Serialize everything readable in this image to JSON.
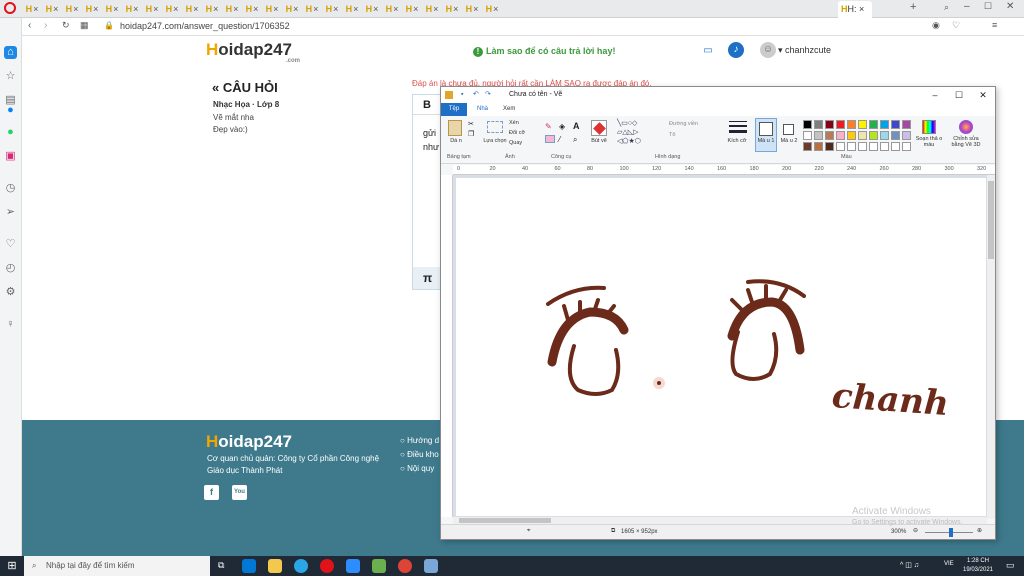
{
  "browser": {
    "tab_count": 24,
    "active_tab": "H:",
    "tab_logo_letter": "H",
    "tab_close": "×",
    "new_tab": "+",
    "url": "hoidap247.com/answer_question/1706352"
  },
  "site": {
    "logo_h": "H",
    "logo_rest": "oidap247",
    "logo_sub": ".com",
    "tip": "Làm sao để có câu trả lời hay!",
    "user": "chanhzcute"
  },
  "question": {
    "title": "CÂU HỎI",
    "subject": "Nhạc Họa · Lớp 8",
    "line1": "Vẽ mắt nha",
    "line2": "Đẹp vào:)",
    "hint": "Đáp án là chưa đủ, người hỏi rất cần LÀM SAO ra được đáp án đó.",
    "editor_bold": "B",
    "editor_text1": "gửi",
    "editor_text2": "như",
    "editor_pi": "π"
  },
  "paint": {
    "title": "Chưa có tên - Vẽ",
    "tabs": [
      "Tệp",
      "Nhà",
      "Xem"
    ],
    "groups": [
      "Bảng tạm",
      "Ảnh",
      "Công cụ",
      "Hình dạng",
      "Màu"
    ],
    "items": {
      "paste": "Dá n",
      "select": "Lựa chọn",
      "crop": "Xén",
      "resize": "Đổi cỡ",
      "rotate": "Quay",
      "brush": "Bút vẽ",
      "outline": "Đường viền",
      "fill": "Tô",
      "size": "Kích cỡ",
      "color1": "Mà u 1",
      "color2": "Mà u 2",
      "edit_colors": "Soạn thả o màu",
      "paint3d": "Chỉnh sửa bằng Vẽ 3D"
    },
    "ruler_ticks": [
      "0",
      "20",
      "40",
      "60",
      "80",
      "100",
      "120",
      "140",
      "160",
      "180",
      "200",
      "220",
      "240",
      "260",
      "280",
      "300",
      "320"
    ],
    "drawing_text": "chanh",
    "size_status": "1605 × 952px",
    "zoom": "300%"
  },
  "palette": [
    "#000000",
    "#7f7f7f",
    "#880015",
    "#ed1c24",
    "#ff7f27",
    "#fff200",
    "#22b14c",
    "#00a2e8",
    "#3f48cc",
    "#a349a4",
    "#ffffff",
    "#c3c3c3",
    "#b97a57",
    "#ffaec9",
    "#ffc90e",
    "#efe4b0",
    "#b5e61d",
    "#99d9ea",
    "#7092be",
    "#c8bfe7",
    "#6b3a2a",
    "#b87040",
    "#502a1c",
    "#ffffff",
    "#ffffff",
    "#ffffff",
    "#ffffff",
    "#ffffff",
    "#ffffff",
    "#ffffff"
  ],
  "footer": {
    "logo_h": "H",
    "logo_rest": "oidap247",
    "owner": "Cơ quan chủ quản: Công ty Cổ phần Công nghệ",
    "owner2": "Giáo dục Thành Phát",
    "links": [
      "Hướng d",
      "Điều kho",
      "Nội quy"
    ],
    "social_fb": "f",
    "social_yt": "You"
  },
  "watermark": {
    "line1": "Activate Windows",
    "line2": "Go to Settings to activate Windows."
  },
  "taskbar": {
    "search": "Nhập tại đây để tìm kiếm",
    "lang": "VIE",
    "time": "1:28 CH",
    "date": "19/03/2021"
  },
  "accent": "#1e6fc6",
  "brown": "#6b2a1a"
}
